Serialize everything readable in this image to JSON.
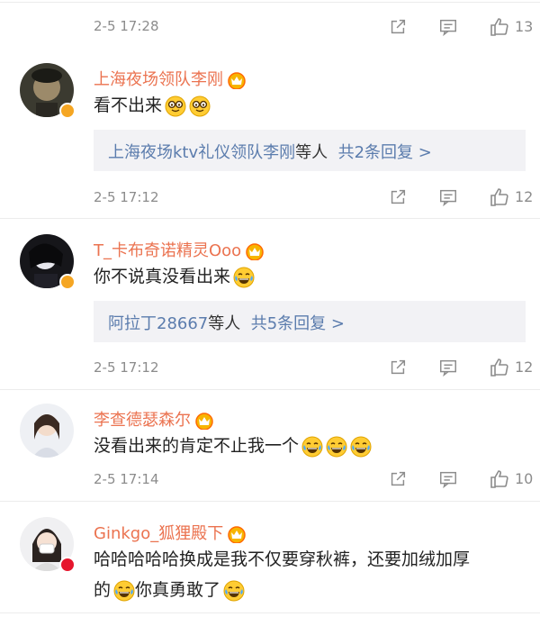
{
  "comments": [
    {
      "meta": {
        "time": "2-5 17:28",
        "likes": "13"
      }
    },
    {
      "name": "上海夜场领队李刚",
      "text": "看不出来",
      "reply": {
        "who": "上海夜场ktv礼仪领队李刚",
        "mid": "等人",
        "count": "共2条回复 >"
      },
      "meta": {
        "time": "2-5 17:12",
        "likes": "12"
      }
    },
    {
      "name": "T_卡布奇诺精灵Ooo",
      "text": "你不说真没看出来",
      "reply": {
        "who": "阿拉丁28667",
        "mid": "等人",
        "count": "共5条回复 >"
      },
      "meta": {
        "time": "2-5 17:12",
        "likes": "12"
      }
    },
    {
      "name": "李查德瑟森尔",
      "text": "没看出来的肯定不止我一个",
      "meta": {
        "time": "2-5 17:14",
        "likes": "10"
      }
    },
    {
      "name": "Ginkgo_狐狸殿下",
      "text_line1": "哈哈哈哈哈换成是我不仅要穿秋裤，还要加绒加厚",
      "text_line2_a": "的",
      "text_line2_b": "你真勇敢了"
    }
  ],
  "colors": {
    "name": "#eb7350",
    "link": "#5b7cad",
    "meta": "#8c8c8c",
    "vip_badge": "#f5a623",
    "red_badge": "#e6162d"
  },
  "icons": [
    "share-icon",
    "comment-icon",
    "like-icon",
    "crown-badge-icon",
    "nerd-emoji-icon",
    "laugh-cry-emoji-icon"
  ]
}
